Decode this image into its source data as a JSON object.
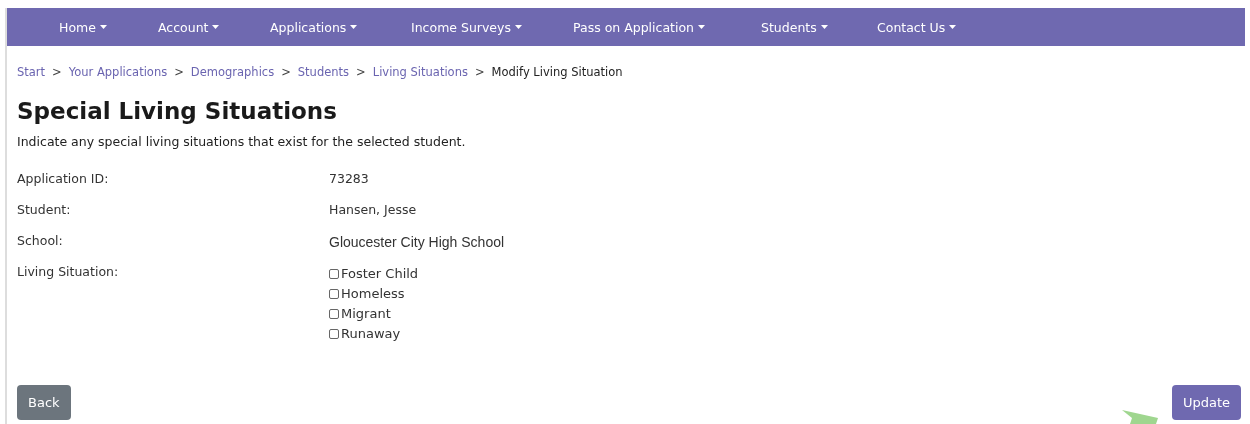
{
  "nav": [
    {
      "label": "Home"
    },
    {
      "label": "Account"
    },
    {
      "label": "Applications"
    },
    {
      "label": "Income Surveys"
    },
    {
      "label": "Pass on Application"
    },
    {
      "label": "Students"
    },
    {
      "label": "Contact Us"
    }
  ],
  "breadcrumb": [
    {
      "label": "Start",
      "link": true
    },
    {
      "separator": ">",
      "label": "Your Applications",
      "link": true
    },
    {
      "separator": ">",
      "label": "Demographics",
      "link": true
    },
    {
      "separator": ">",
      "label": "Students",
      "link": true
    },
    {
      "separator": ">",
      "label": "Living Situations",
      "link": true
    },
    {
      "separator": ">",
      "label": "Modify Living Situation",
      "link": false
    }
  ],
  "title": "Special Living Situations",
  "description": "Indicate any special living situations that exist for the selected student.",
  "fields": [
    {
      "kind": "text",
      "label": "Application ID:",
      "value": "73283"
    },
    {
      "kind": "text",
      "label": "Student:",
      "value": "Hansen, Jesse"
    },
    {
      "kind": "plain",
      "label": "School:",
      "value": "Gloucester City High School"
    },
    {
      "kind": "checks",
      "label": "Living Situation:",
      "options": [
        {
          "label": "Foster Child",
          "checked": false
        },
        {
          "label": "Homeless",
          "checked": false
        },
        {
          "label": "Migrant",
          "checked": false
        },
        {
          "label": "Runaway",
          "checked": false
        }
      ]
    }
  ],
  "buttons": [
    {
      "label": "Back",
      "kind": "secondary"
    },
    {
      "label": "Update",
      "kind": "primary"
    }
  ]
}
